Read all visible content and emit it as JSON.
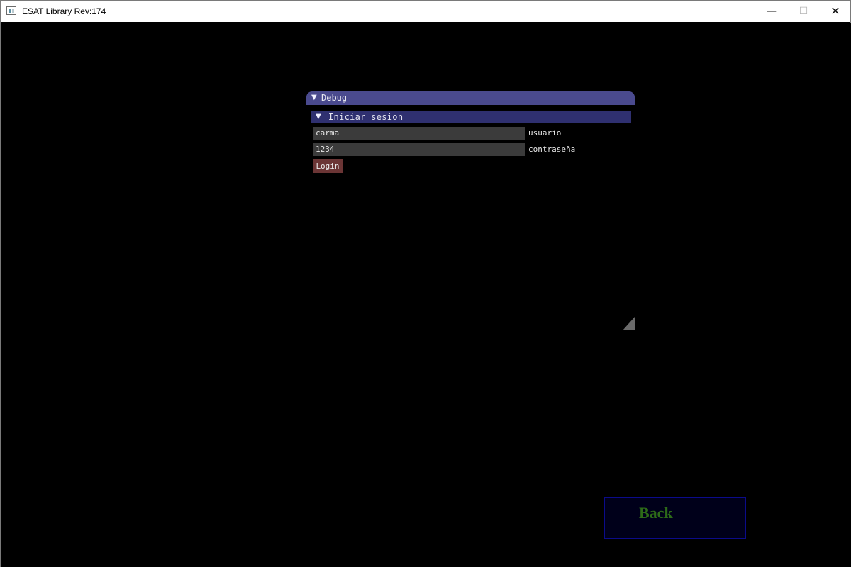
{
  "window": {
    "title": "ESAT Library Rev:174",
    "controls": {
      "minimize_glyph": "—",
      "maximize_glyph": "☐",
      "close_glyph": "✕"
    },
    "icon": "app-window-icon"
  },
  "debug_panel": {
    "title": "Debug",
    "collapse_glyph": "▼",
    "section": {
      "title": "Iniciar sesion",
      "collapse_glyph": "▼"
    },
    "fields": {
      "user_value": "carma",
      "user_label": "usuario",
      "password_value": "1234",
      "password_label": "contraseña"
    },
    "login_label": "Login",
    "icons": {
      "resize": "resize-grip-icon"
    }
  },
  "back_button": {
    "label": "Back"
  },
  "colors": {
    "background": "#000000",
    "panel_title": "#4a4a8e",
    "section_header": "#2f3070",
    "input_bg": "#3b3b3b",
    "login_button": "#6b3535",
    "back_border": "#0b0b8a",
    "back_text": "#2d6b18"
  }
}
